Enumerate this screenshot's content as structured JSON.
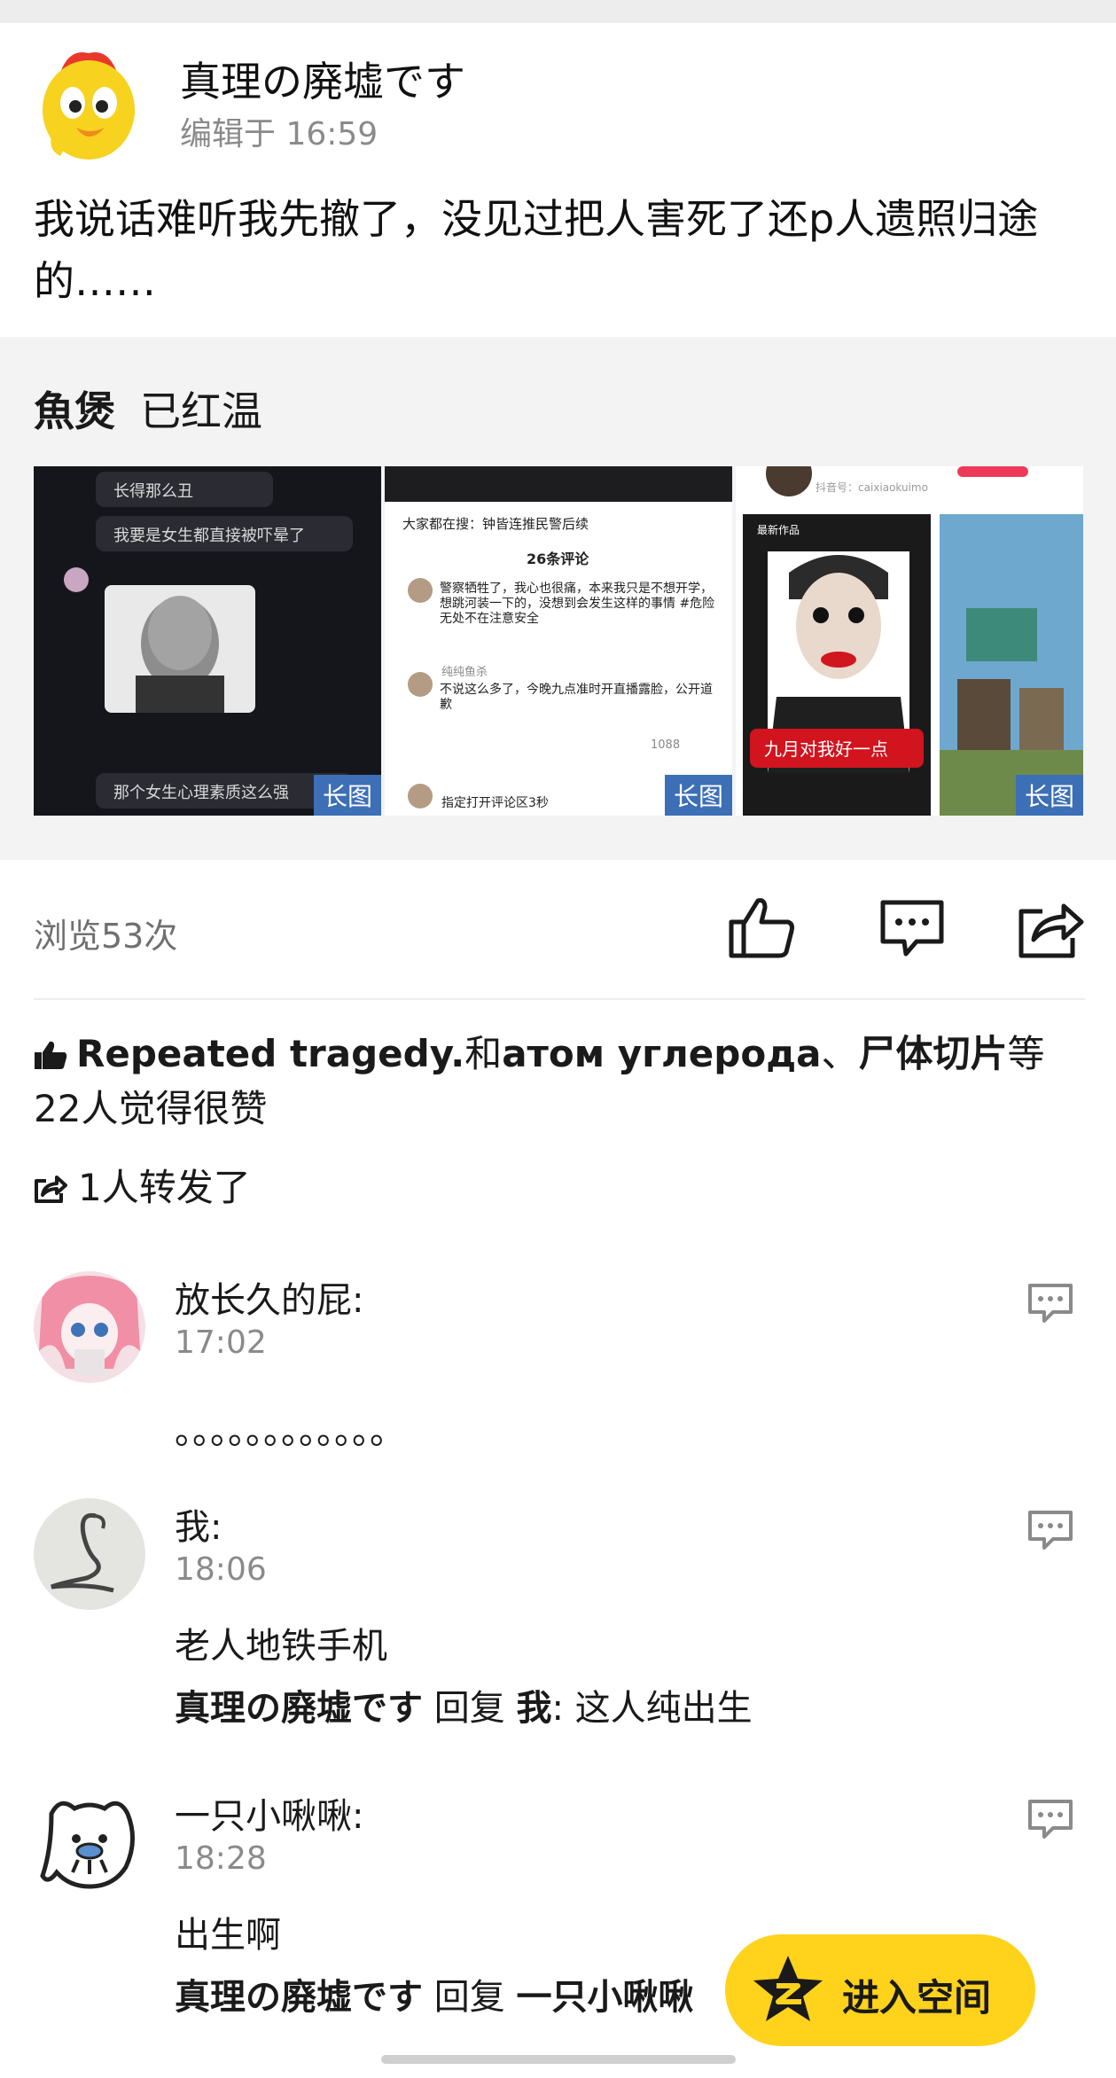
{
  "post": {
    "author": "真理の廃墟です",
    "edit_time": "编辑于 16:59",
    "text": "我说话难听我先撤了，没见过把人害死了还p人遗照归途的……"
  },
  "shared": {
    "author": "魚煲",
    "text": "已红温",
    "images": [
      {
        "badge": "长图",
        "lines": [
          "长得那么丑",
          "我要是女生都直接被吓晕了",
          "那个女生心理素质这么强"
        ]
      },
      {
        "badge": "长图",
        "lines": [
          "大家都在搜：钟皆连推民警后续",
          "26条评论",
          "警察牺牲了，我心也很痛，本来我只是不想开学，想跳河装一下的，没想到会发生这样的事情 #危险无处不在注意安全",
          "纯纯鱼杀",
          "不说这么多了，今晚九点准时开直播露脸，公开道歉",
          "1088",
          "指定打开评论区3秒"
        ]
      },
      {
        "badge": "长图",
        "lines": [
          "抖音号：caixiaokuimo",
          "最新作品",
          "九月对我好一点"
        ]
      }
    ]
  },
  "stats": {
    "views": "浏览53次",
    "like_icon": "thumbs-up-icon",
    "comment_icon": "comment-bubble-icon",
    "share_icon": "share-arrow-icon"
  },
  "likes": {
    "user1": "Repeated tragedy.",
    "and": "和",
    "user2": "атом углерода",
    "sep": "、",
    "user3": "尸体切片",
    "suffix": "等22人觉得很赞"
  },
  "reposts": "1人转发了",
  "comments": [
    {
      "name": "放长久的屁:",
      "time": "17:02",
      "text": "。。。。。。。。。。。。"
    },
    {
      "name": "我:",
      "time": "18:06",
      "text": "老人地铁手机",
      "reply": {
        "from": "真理の廃墟です",
        "verb": " 回复 ",
        "to": "我",
        "text": ": 这人纯出生"
      }
    },
    {
      "name": "一只小啾啾:",
      "time": "18:28",
      "text": "出生啊",
      "reply": {
        "from": "真理の廃墟です",
        "verb": " 回复 ",
        "to": "一只小啾啾",
        "text": ""
      }
    }
  ],
  "enter_space": "进入空间",
  "colors": {
    "accent_yellow": "#ffd21c",
    "badge_blue": "#3d6fb6",
    "gray_text": "#8a8a8a",
    "panel_bg": "#f3f3f3"
  }
}
